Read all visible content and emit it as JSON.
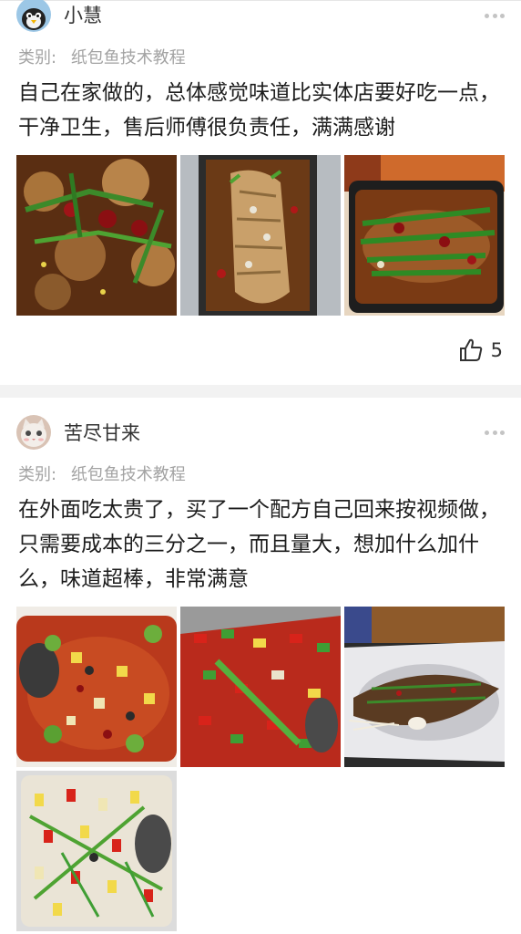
{
  "reviews": [
    {
      "username": "小慧",
      "avatar_icon": "cartoon-bird-avatar",
      "category_label": "类别:",
      "category_value": "纸包鱼技术教程",
      "text": "自己在家做的，总体感觉味道比实体店要好吃一点，干净卫生，售后师傅很负责任，满满感谢",
      "photos": [
        "frog-stew-photo",
        "grilled-fish-tray-photo",
        "fish-with-scallions-photo"
      ],
      "like_count": "5"
    },
    {
      "username": "苦尽甘来",
      "avatar_icon": "cat-avatar",
      "category_label": "类别:",
      "category_value": "纸包鱼技术教程",
      "text": "在外面吃太贵了，买了一个配方自己回来按视频做，只需要成本的三分之一，而且量大，想加什么加什么，味道超棒，非常满意",
      "photos": [
        "fish-with-vegetables-photo",
        "peppers-fish-photo",
        "paper-wrapped-fish-photo",
        "colorful-fish-platter-photo"
      ]
    }
  ],
  "colors": {
    "username": "#333333",
    "category": "#a3a3a3",
    "body_text": "#1d1d1d",
    "separator": "#f2f2f2"
  }
}
